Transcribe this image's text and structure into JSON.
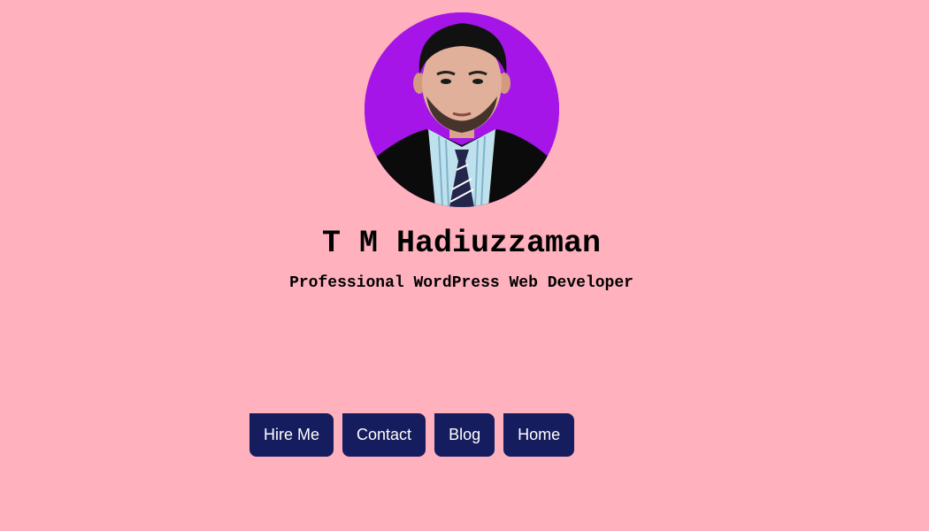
{
  "profile": {
    "photo_icon": "profile-photo",
    "name": "T M Hadiuzzaman",
    "tagline": "Professional WordPress Web Developer"
  },
  "nav": {
    "buttons": [
      "Hire Me",
      "Contact",
      "Blog",
      "Home"
    ]
  },
  "colors": {
    "page_background": "#ffb1bd",
    "avatar_background": "#a515e8",
    "button_background": "#161d5e",
    "button_text": "#ffffff"
  }
}
